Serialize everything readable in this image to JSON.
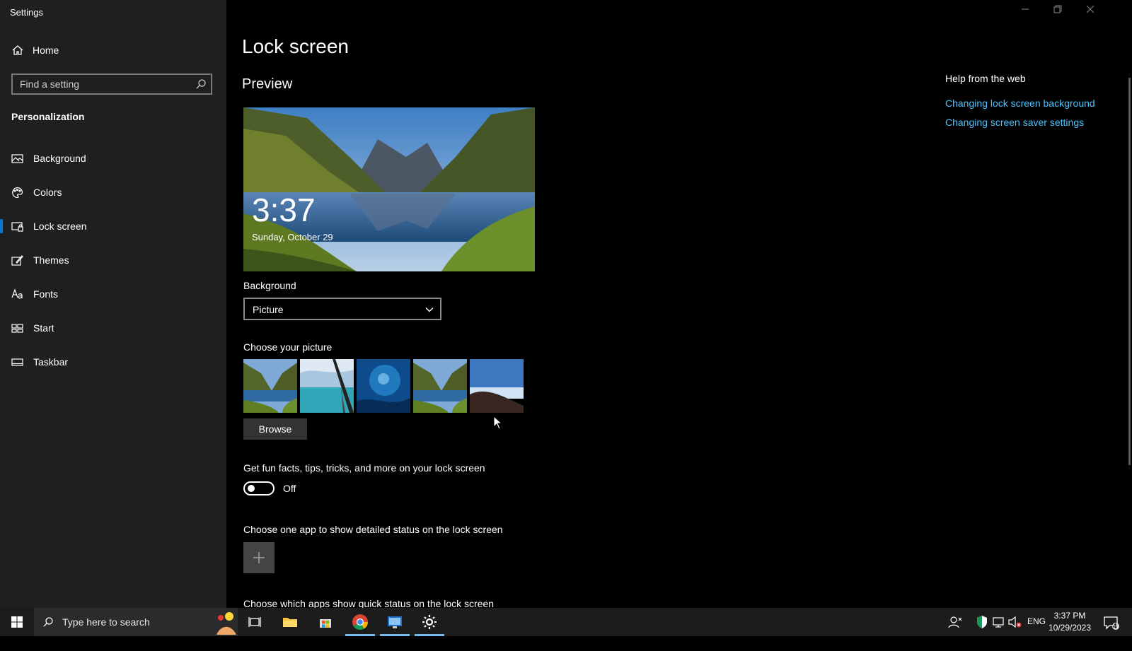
{
  "window": {
    "title": "Settings"
  },
  "sidebar": {
    "home_label": "Home",
    "search_placeholder": "Find a setting",
    "section_title": "Personalization",
    "items": [
      {
        "label": "Background",
        "icon": "picture-icon",
        "active": false
      },
      {
        "label": "Colors",
        "icon": "palette-icon",
        "active": false
      },
      {
        "label": "Lock screen",
        "icon": "lock-screen-icon",
        "active": true
      },
      {
        "label": "Themes",
        "icon": "themes-brush-icon",
        "active": false
      },
      {
        "label": "Fonts",
        "icon": "font-icon",
        "active": false
      },
      {
        "label": "Start",
        "icon": "start-grid-icon",
        "active": false
      },
      {
        "label": "Taskbar",
        "icon": "taskbar-icon",
        "active": false
      }
    ]
  },
  "main": {
    "page_title": "Lock screen",
    "preview_heading": "Preview",
    "preview_time": "3:37",
    "preview_date": "Sunday, October 29",
    "background_label": "Background",
    "background_value": "Picture",
    "choose_picture_label": "Choose your picture",
    "browse_label": "Browse",
    "fun_facts_label": "Get fun facts, tips, tricks, and more on your lock screen",
    "fun_facts_state": "Off",
    "detailed_status_label": "Choose one app to show detailed status on the lock screen",
    "quick_status_label": "Choose which apps show quick status on the lock screen"
  },
  "help": {
    "heading": "Help from the web",
    "links": [
      "Changing lock screen background",
      "Changing screen saver settings"
    ]
  },
  "taskbar": {
    "search_placeholder": "Type here to search",
    "language": "ENG",
    "time": "3:37 PM",
    "date": "10/29/2023",
    "notification_count": "4"
  },
  "colors": {
    "accent": "#0078d7",
    "link": "#4cc2ff",
    "sidebar_bg": "#1f1f1f"
  }
}
